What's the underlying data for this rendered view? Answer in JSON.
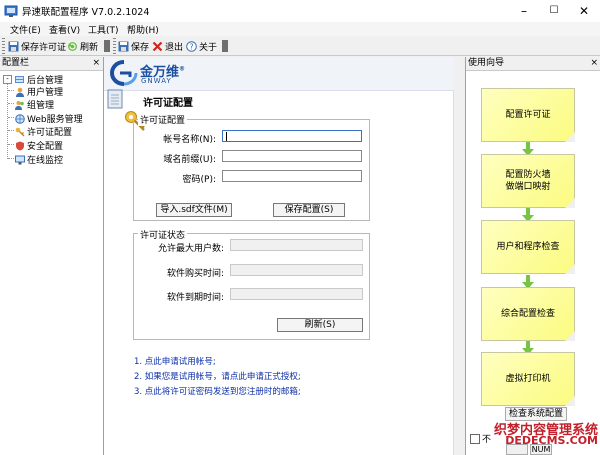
{
  "window": {
    "title": "异速联配置程序 V7.0.2.1024",
    "minimize": "–",
    "maximize": "☐",
    "close": "✕"
  },
  "menu": [
    "文件(E)",
    "查看(V)",
    "工具(T)",
    "帮助(H)"
  ],
  "toolbar": {
    "save_license": "保存许可证",
    "refresh": "刷新",
    "save": "保存",
    "exit": "退出",
    "about": "关于"
  },
  "left_panel": {
    "title": "配置栏",
    "close": "×",
    "root": "后台管理",
    "items": [
      "用户管理",
      "组管理",
      "Web服务管理",
      "许可证配置",
      "安全配置",
      "在线监控"
    ]
  },
  "logo": {
    "cn": "金万维",
    "en": "GNWAY",
    "reg": "®"
  },
  "page": {
    "title": "许可证配置",
    "license_group": {
      "legend": "许可证配置",
      "account_label": "帐号名称(N):",
      "domain_label": "域名前缀(U):",
      "password_label": "密码(P):",
      "account_value": "",
      "domain_value": "",
      "password_value": "",
      "import_button": "导入.sdf文件(M)",
      "save_button": "保存配置(S)"
    },
    "status_group": {
      "legend": "许可证状态",
      "max_users_label": "允许最大用户数:",
      "purchase_time_label": "软件购买时间:",
      "expire_time_label": "软件到期时间:",
      "max_users_value": "",
      "purchase_time_value": "",
      "expire_time_value": "",
      "refresh_button": "刷新(S)"
    },
    "links": [
      "1. 点此申请试用帐号;",
      "2. 如果您是试用帐号，请点此申请正式授权;",
      "3. 点此将许可证密码发送到您注册时的邮箱;"
    ]
  },
  "right_panel": {
    "title": "使用向导",
    "close": "×",
    "steps": [
      "配置许可证",
      "配置防火墙\n做端口映射",
      "用户和程序检查",
      "综合配置检查",
      "虚拟打印机"
    ],
    "check_button": "检查系统配置",
    "checkbox_label": "不"
  },
  "status_bar": {
    "num": "NUM"
  },
  "watermark": {
    "line1": "织梦内容管理系统",
    "line2": "DEDECMS.COM"
  },
  "colors": {
    "accent": "#1c4fa0",
    "flow_fill": "#fbfb80",
    "arrow": "#76c442",
    "link": "#0b2ea8"
  }
}
